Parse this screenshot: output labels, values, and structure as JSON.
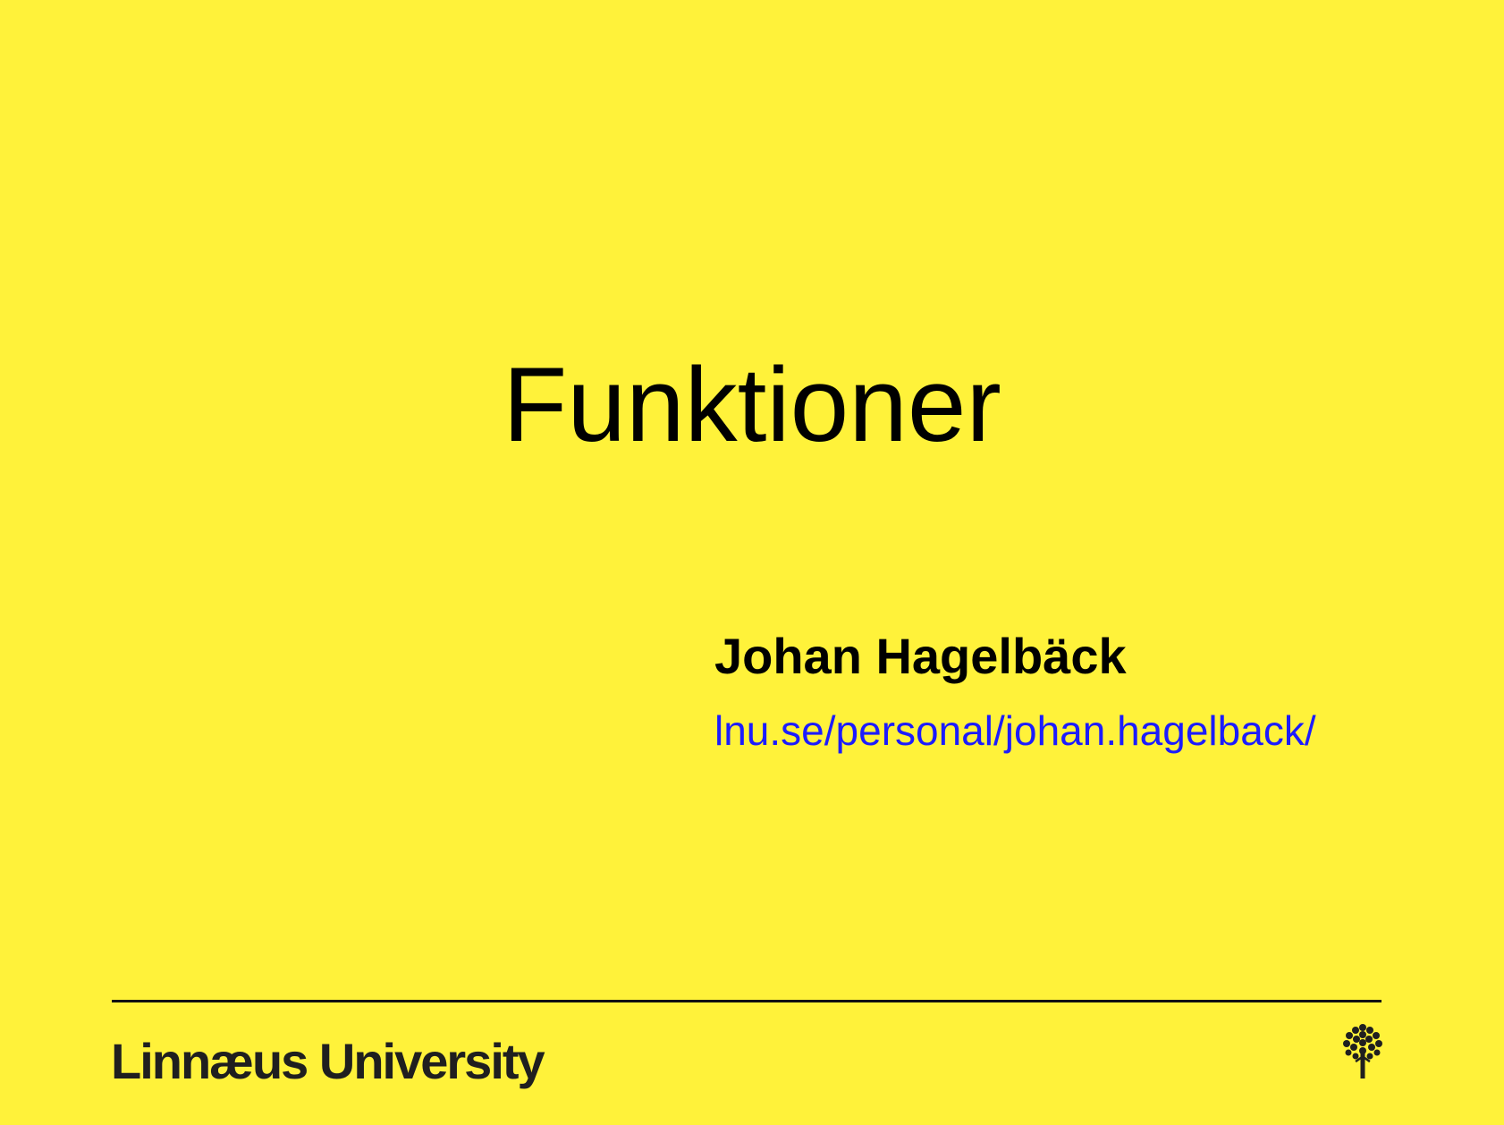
{
  "slide": {
    "title": "Funktioner",
    "author": "Johan Hagelbäck",
    "link_text": "lnu.se/personal/johan.hagelback/"
  },
  "footer": {
    "logo_text": "Linnæus University",
    "logo_icon": "tree-icon"
  },
  "colors": {
    "background": "#fff23a",
    "text": "#000000",
    "link": "#1c1cff"
  }
}
